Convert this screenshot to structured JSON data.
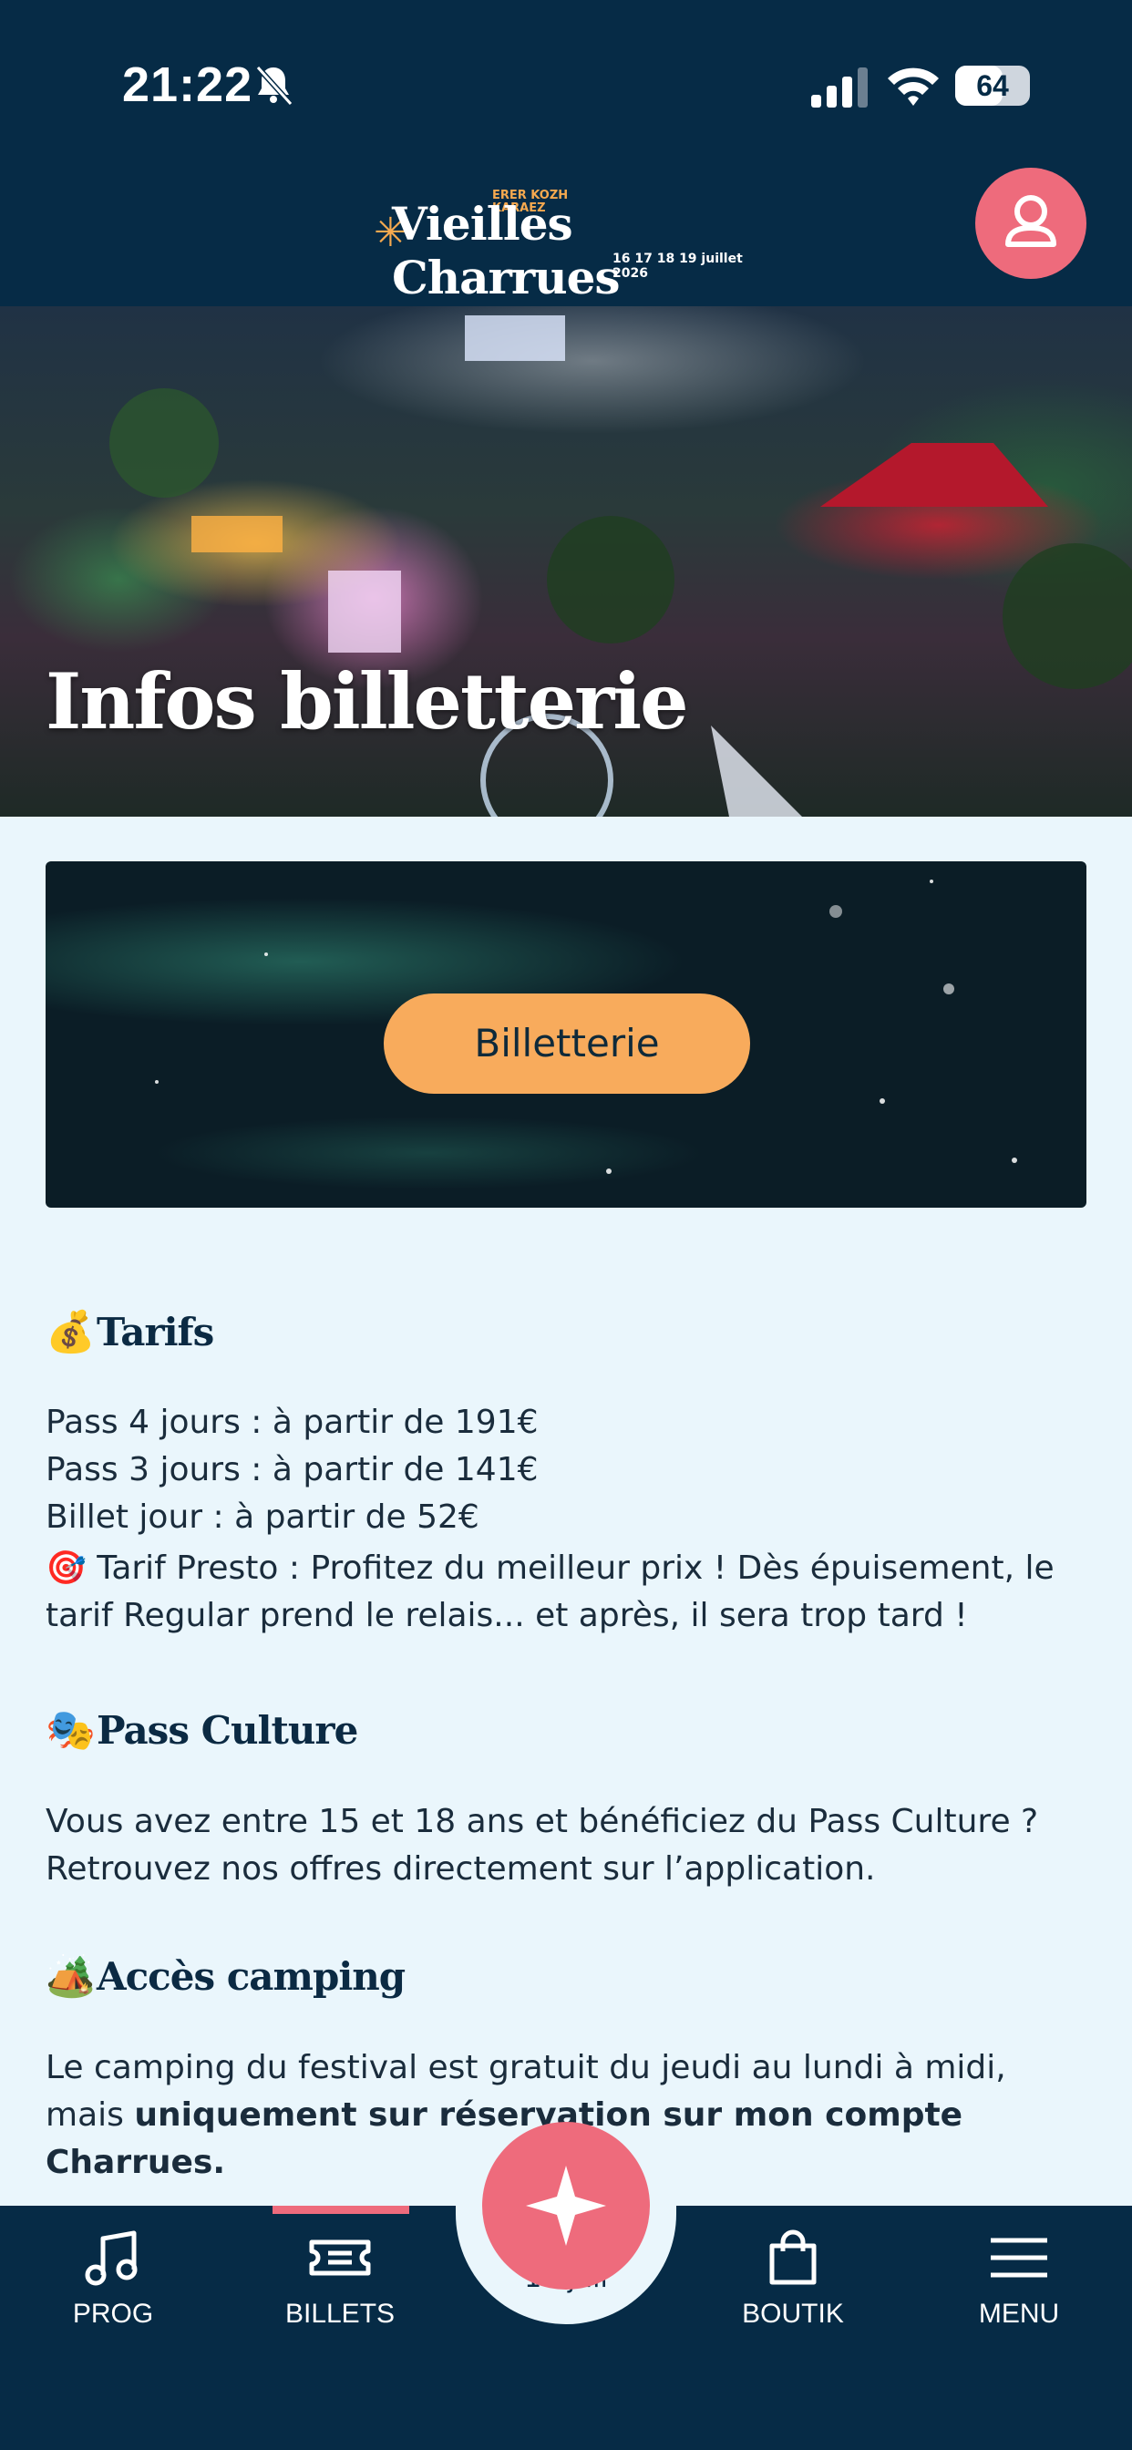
{
  "status_bar": {
    "time": "21:22",
    "battery": "64",
    "battery_level": 0.64
  },
  "header": {
    "logo_top": "ERER KOZH\nKARAEZ",
    "logo_main": "Vieilles Charrues",
    "logo_date": "16 17 18 19  juillet 2026"
  },
  "hero": {
    "title": "Infos billetterie"
  },
  "ticket_button": "Billetterie",
  "sections": {
    "tarifs": {
      "emoji": "💰",
      "title": "Tarifs",
      "lines": [
        "Pass 4 jours : à partir de 191€",
        "Pass 3 jours : à partir de 141€",
        "Billet jour : à partir de 52€"
      ],
      "presto_emoji": "🎯",
      "presto": "Tarif Presto : Profitez du meilleur prix ! Dès épuisement, le tarif Regular prend le relais... et après, il sera trop tard !"
    },
    "pass_culture": {
      "emoji": "🎭",
      "title": "Pass Culture",
      "text": "Vous avez entre 15 et 18 ans et bénéficiez du Pass Culture ? Retrouvez nos offres directement sur l’application."
    },
    "camping": {
      "emoji": "🏕️",
      "title": "Accès camping",
      "text": "Le camping du festival est gratuit du jeudi au lundi à midi, mais",
      "bold": "uniquement sur réservation sur mon compte Charrues."
    }
  },
  "tabbar": {
    "items": [
      {
        "label": "PROG",
        "icon": "music-note-icon"
      },
      {
        "label": "BILLETS",
        "icon": "ticket-icon"
      },
      {
        "label": "BOUTIK",
        "icon": "shopping-bag-icon"
      },
      {
        "label": "MENU",
        "icon": "hamburger-menu-icon"
      }
    ],
    "hidden_text": "17 juil"
  }
}
